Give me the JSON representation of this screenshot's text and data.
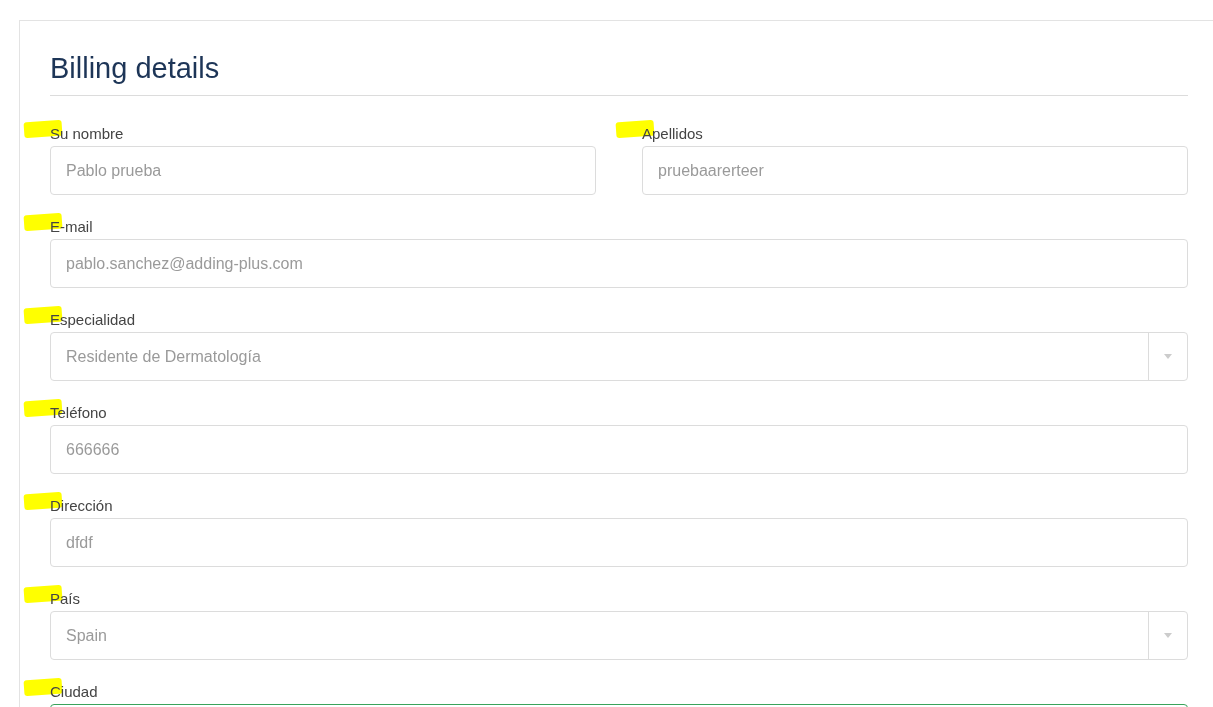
{
  "heading": "Billing details",
  "rows": [
    {
      "fields": [
        {
          "kind": "text",
          "label": "Su nombre",
          "value": "Pablo prueba",
          "highlighted": true,
          "focused": false
        },
        {
          "kind": "text",
          "label": "Apellidos",
          "value": "pruebaarerteer",
          "highlighted": true,
          "focused": false
        }
      ]
    },
    {
      "fields": [
        {
          "kind": "text",
          "label": "E-mail",
          "value": "pablo.sanchez@adding-plus.com",
          "highlighted": true,
          "focused": false
        }
      ]
    },
    {
      "fields": [
        {
          "kind": "select",
          "label": "Especialidad",
          "value": "Residente de Dermatología",
          "highlighted": true,
          "focused": false
        }
      ]
    },
    {
      "fields": [
        {
          "kind": "text",
          "label": "Teléfono",
          "value": "666666",
          "highlighted": true,
          "focused": false
        }
      ]
    },
    {
      "fields": [
        {
          "kind": "text",
          "label": "Dirección",
          "value": "dfdf",
          "highlighted": true,
          "focused": false
        }
      ]
    },
    {
      "fields": [
        {
          "kind": "select",
          "label": "País",
          "value": "Spain",
          "highlighted": true,
          "focused": false
        }
      ]
    },
    {
      "fields": [
        {
          "kind": "text",
          "label": "Ciudad",
          "highlighted": true,
          "focused": true
        }
      ]
    }
  ]
}
